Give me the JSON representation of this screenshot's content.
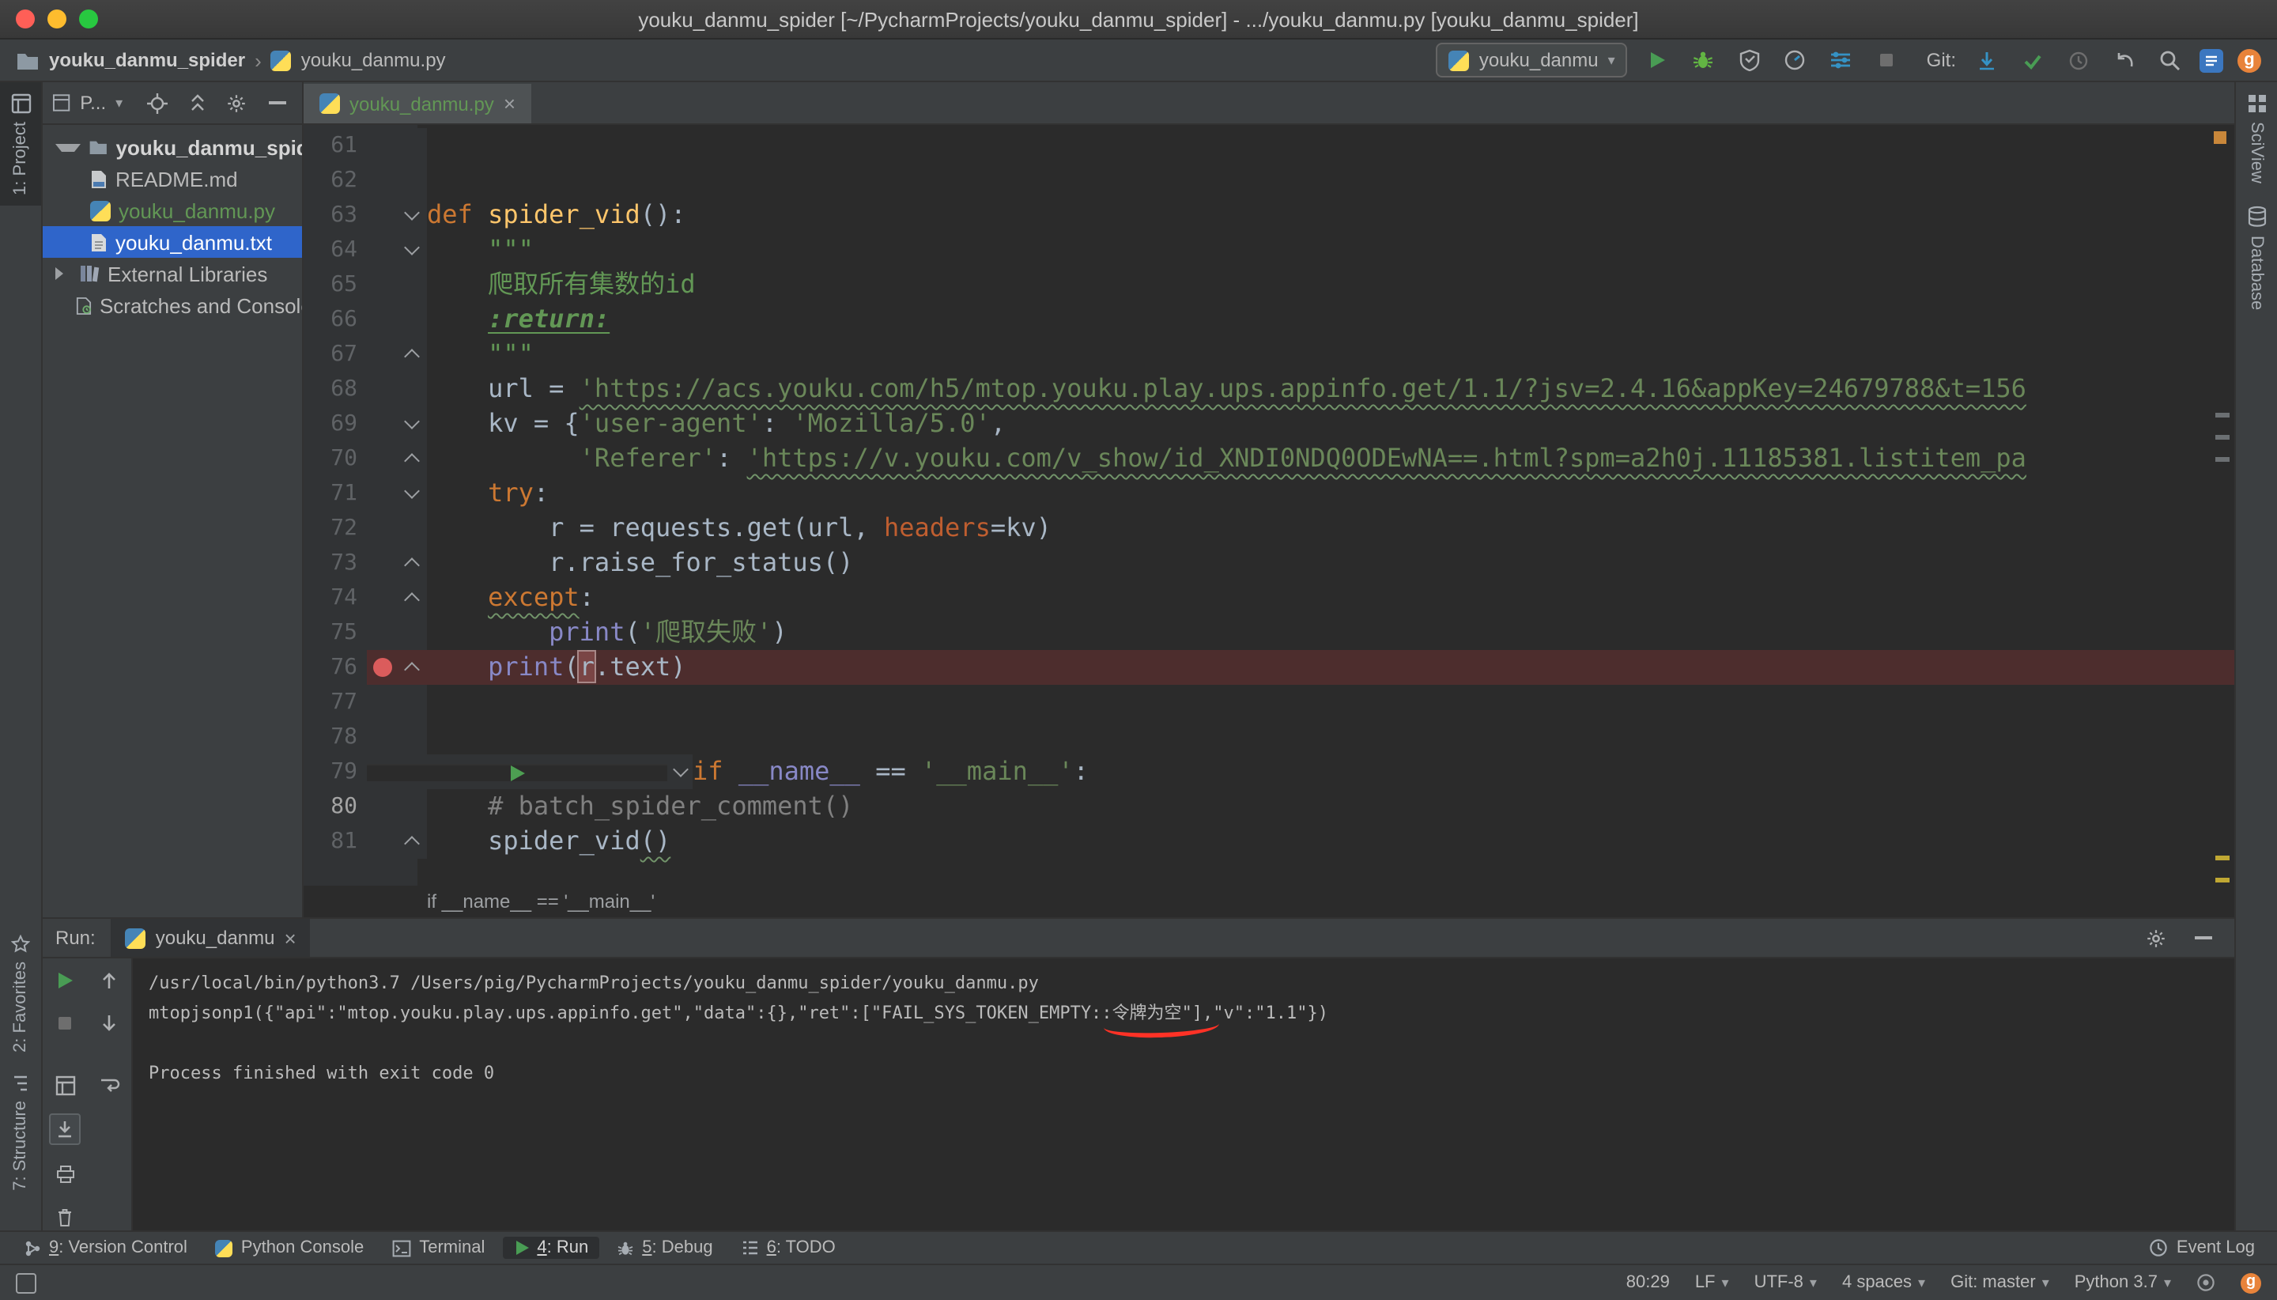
{
  "colors": {
    "panel_bg": "#3c3f41",
    "editor_bg": "#2b2b2b",
    "gutter_bg": "#313335",
    "selection_blue": "#2f65ca",
    "accent_blue": "#3592c4",
    "run_green": "#499c54",
    "vcs_added_green": "#629755",
    "keyword_orange": "#cc7832",
    "string_green": "#6a8759",
    "breakpoint_red": "#db5c5c",
    "breakpoint_line_bg": "#4d2d2d",
    "error_underline_red": "#ff3226",
    "mac_close": "#ff5f57",
    "mac_minimize": "#febc2e",
    "mac_zoom": "#28c840"
  },
  "titlebar": {
    "title": "youku_danmu_spider [~/PycharmProjects/youku_danmu_spider] - .../youku_danmu.py [youku_danmu_spider]"
  },
  "navbar": {
    "breadcrumb_project": "youku_danmu_spider",
    "breadcrumb_file": "youku_danmu.py",
    "run_config": "youku_danmu",
    "git_label": "Git:"
  },
  "left_stripe": {
    "project": "1: Project",
    "favorites": "2: Favorites",
    "structure": "7: Structure"
  },
  "right_stripe": {
    "sciview": "SciView",
    "database": "Database"
  },
  "project_panel": {
    "header_label": "P...",
    "tree": [
      {
        "label": "youku_danmu_spider"
      },
      {
        "label": "README.md"
      },
      {
        "label": "youku_danmu.py"
      },
      {
        "label": "youku_danmu.txt"
      },
      {
        "label": "External Libraries"
      },
      {
        "label": "Scratches and Consoles"
      }
    ]
  },
  "editor": {
    "tab": "youku_danmu.py",
    "breadcrumb": "if __name__ == '__main__'",
    "lines": [
      {
        "num": 61,
        "t": []
      },
      {
        "num": 62,
        "t": []
      },
      {
        "num": 63,
        "fold": "v",
        "t": [
          [
            "k",
            "def"
          ],
          [
            "p",
            " "
          ],
          [
            "f",
            "spider_vid"
          ],
          [
            "p",
            "():"
          ]
        ]
      },
      {
        "num": 64,
        "fold": "v",
        "t": [
          [
            "d",
            "    \"\"\""
          ]
        ]
      },
      {
        "num": 65,
        "t": [
          [
            "d",
            "    爬取所有集数的id"
          ]
        ]
      },
      {
        "num": 66,
        "t": [
          [
            "d",
            "    "
          ],
          [
            "dt",
            ":return:"
          ]
        ]
      },
      {
        "num": 67,
        "fold": "e",
        "t": [
          [
            "d",
            "    \"\"\""
          ]
        ]
      },
      {
        "num": 68,
        "t": [
          [
            "p",
            "    url = "
          ],
          [
            "s sq",
            "'https://acs.youku.com/h5/mtop.youku.play.ups.appinfo.get/1.1/?jsv=2.4.16&appKey=24679788&t=156"
          ]
        ]
      },
      {
        "num": 69,
        "fold": "v",
        "t": [
          [
            "p",
            "    kv = {"
          ],
          [
            "s",
            "'user-agent'"
          ],
          [
            "p",
            ": "
          ],
          [
            "s",
            "'Mozilla/5.0'"
          ],
          [
            "p",
            ","
          ]
        ]
      },
      {
        "num": 70,
        "fold": "e",
        "t": [
          [
            "p",
            "          "
          ],
          [
            "s",
            "'Referer'"
          ],
          [
            "p",
            ": "
          ],
          [
            "s sq",
            "'https://v.youku.com/v_show/id_XNDI0NDQ0ODEwNA==.html?spm=a2h0j.11185381.listitem_pa"
          ]
        ]
      },
      {
        "num": 71,
        "fold": "v",
        "t": [
          [
            "p",
            "    "
          ],
          [
            "k",
            "try"
          ],
          [
            "p",
            ":"
          ]
        ]
      },
      {
        "num": 72,
        "t": [
          [
            "p",
            "        r = requests.get(url, "
          ],
          [
            "a",
            "headers"
          ],
          [
            "p",
            "=kv)"
          ]
        ]
      },
      {
        "num": 73,
        "fold": "e",
        "t": [
          [
            "p",
            "        r.raise_for_status()"
          ]
        ]
      },
      {
        "num": 74,
        "fold": "e",
        "t": [
          [
            "p",
            "    "
          ],
          [
            "k sq",
            "except"
          ],
          [
            "p",
            ":"
          ]
        ]
      },
      {
        "num": 75,
        "t": [
          [
            "p",
            "        "
          ],
          [
            "b",
            "print"
          ],
          [
            "p",
            "("
          ],
          [
            "s",
            "'爬取失败'"
          ],
          [
            "p",
            ")"
          ]
        ]
      },
      {
        "num": 76,
        "fold": "e",
        "mark": "bp",
        "hl": true,
        "t": [
          [
            "p",
            "    "
          ],
          [
            "b",
            "print"
          ],
          [
            "p",
            "("
          ],
          [
            "box",
            "r"
          ],
          [
            "p",
            ".text)"
          ]
        ]
      },
      {
        "num": 77,
        "t": []
      },
      {
        "num": 78,
        "t": []
      },
      {
        "num": 79,
        "fold": "v",
        "mark": "run",
        "t": [
          [
            "k",
            "if"
          ],
          [
            "p",
            " "
          ],
          [
            "b",
            "__name__"
          ],
          [
            "p",
            " == "
          ],
          [
            "s",
            "'__main__'"
          ],
          [
            "p",
            ":"
          ]
        ]
      },
      {
        "num": 80,
        "cur": true,
        "t": [
          [
            "c",
            "    # batch_spider_comment()"
          ]
        ]
      },
      {
        "num": 81,
        "fold": "e",
        "t": [
          [
            "p",
            "    spider_vid"
          ],
          [
            "p sq",
            "()"
          ]
        ]
      }
    ]
  },
  "run_panel": {
    "label": "Run:",
    "tab": "youku_danmu",
    "console": [
      [
        [
          "t",
          "/usr/local/bin/python3.7 /Users/pig/PycharmProjects/youku_danmu_spider/youku_danmu.py"
        ]
      ],
      [
        [
          "t",
          "mtopjsonp1({\"api\":\"mtop.youku.play.ups.appinfo.get\",\"data\":{},\"ret\":[\"FAIL_SYS_TOKEN_EMPTY::"
        ],
        [
          "t swoosh",
          "令牌为空"
        ],
        [
          "t",
          "\"],\"v\":\"1.1\"})"
        ]
      ],
      [],
      [
        [
          "t",
          "Process finished with exit code 0"
        ]
      ]
    ]
  },
  "bottom_bar": {
    "items": [
      {
        "num": "9",
        "rest": ": Version Control"
      },
      {
        "num": "",
        "rest": "Python Console"
      },
      {
        "num": "",
        "rest": "Terminal"
      },
      {
        "num": "4",
        "rest": ": Run"
      },
      {
        "num": "5",
        "rest": ": Debug"
      },
      {
        "num": "6",
        "rest": ": TODO"
      }
    ],
    "event_log": "Event Log"
  },
  "status_bar": {
    "caret": "80:29",
    "line_ending": "LF",
    "encoding": "UTF-8",
    "indent": "4 spaces",
    "git_branch": "Git: master",
    "interpreter": "Python 3.7"
  }
}
